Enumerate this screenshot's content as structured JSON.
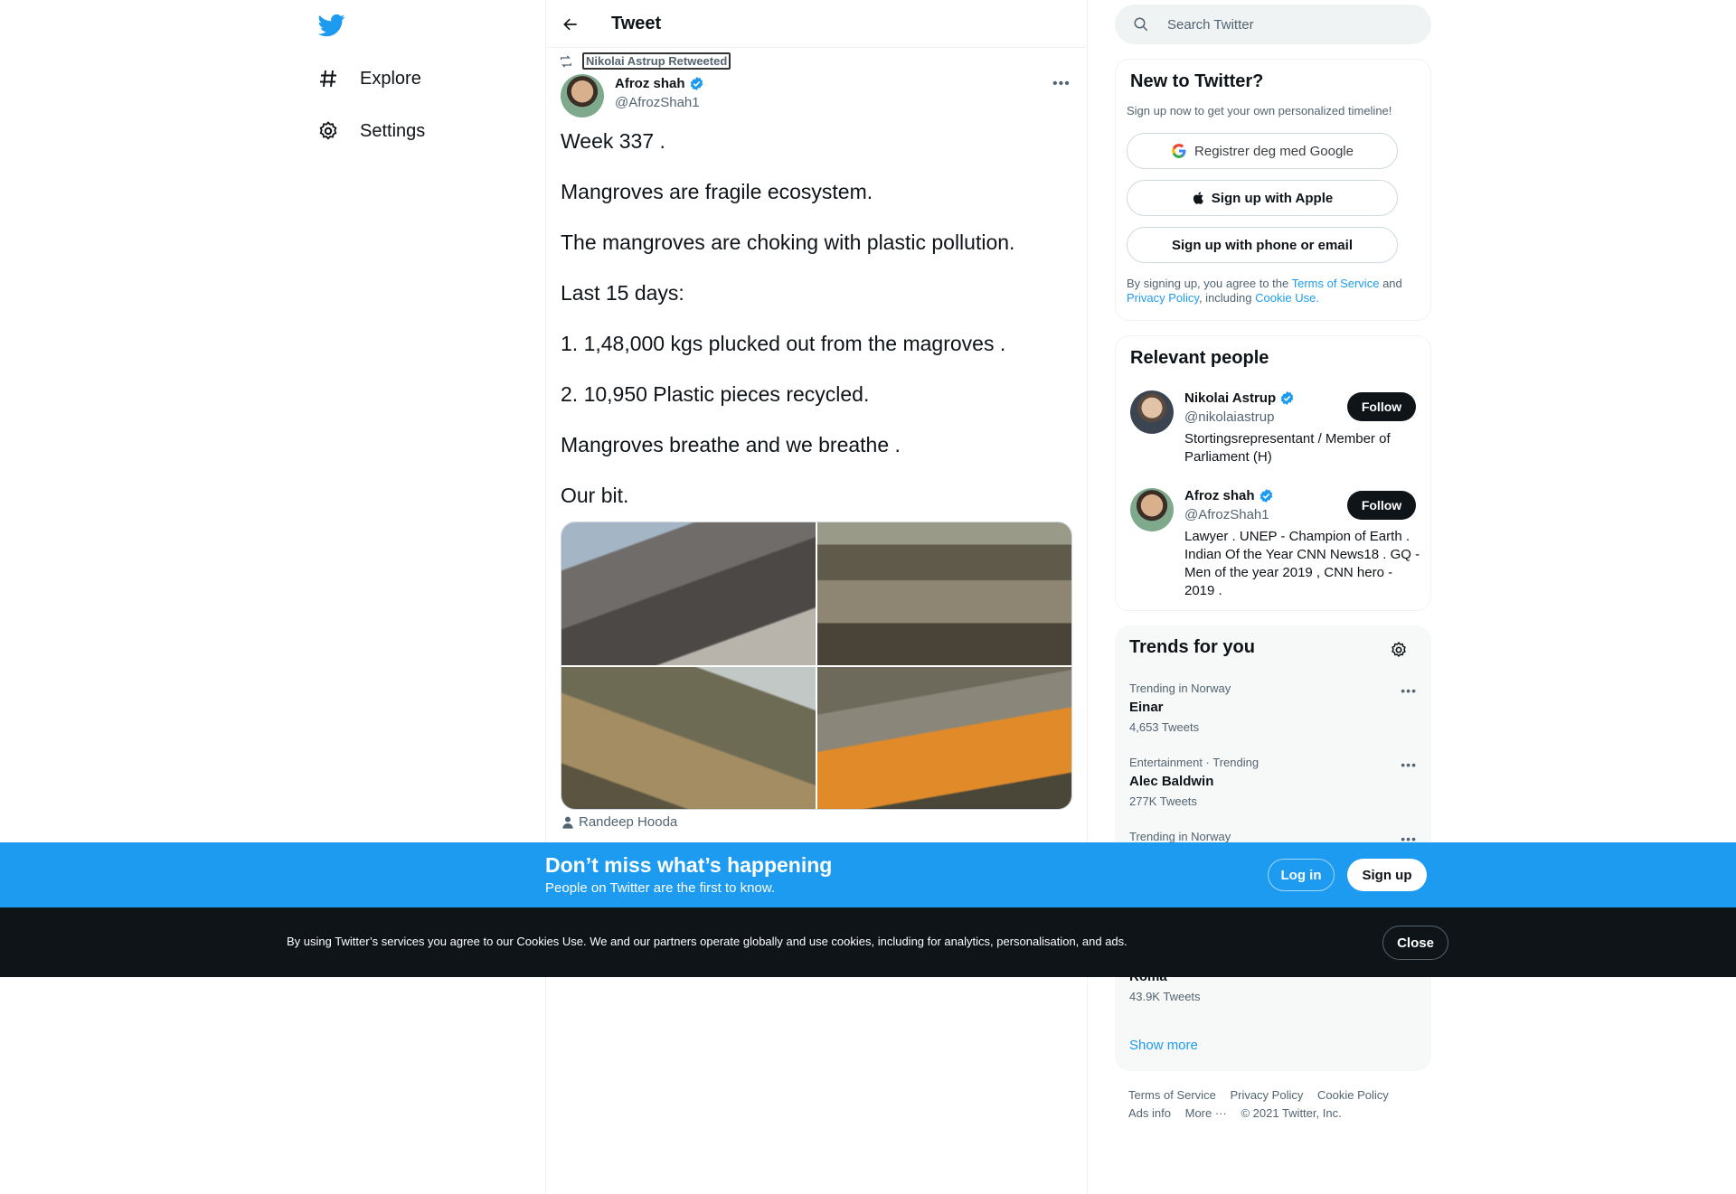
{
  "nav": {
    "logo_icon": "twitter-bird-icon",
    "items": [
      {
        "label": "Explore",
        "icon": "hashtag-icon"
      },
      {
        "label": "Settings",
        "icon": "gear-icon"
      }
    ]
  },
  "header": {
    "title": "Tweet",
    "back_icon": "arrow-left-icon"
  },
  "tweet": {
    "retweeted_by": "Nikolai Astrup Retweeted",
    "author_name": "Afroz shah",
    "author_handle": "@AfrozShah1",
    "paragraphs": [
      "Week 337 .",
      "Mangroves are fragile ecosystem.",
      "The mangroves are choking with plastic pollution.",
      "Last 15 days:",
      "1. 1,48,000 kgs plucked out from the magroves .",
      "2. 10,950 Plastic pieces recycled.",
      "Mangroves breathe and we breathe .",
      "Our bit."
    ],
    "tagged_user": "Randeep Hooda"
  },
  "search": {
    "placeholder": "Search Twitter"
  },
  "new_to_twitter": {
    "title": "New to Twitter?",
    "subtitle": "Sign up now to get your own personalized timeline!",
    "google_label": "Registrer deg med Google",
    "apple_label": "Sign up with Apple",
    "phone_label": "Sign up with phone or email",
    "legal_prefix": "By signing up, you agree to the",
    "terms_link": "Terms of Service",
    "and": "and",
    "privacy_link": "Privacy Policy",
    "including": ", including",
    "cookie_link": "Cookie Use."
  },
  "relevant_people": {
    "title": "Relevant people",
    "people": [
      {
        "name": "Nikolai Astrup",
        "handle": "@nikolaiastrup",
        "bio": "Stortingsrepresentant / Member of Parliament (H)",
        "follow": "Follow"
      },
      {
        "name": "Afroz shah",
        "handle": "@AfrozShah1",
        "bio": "Lawyer . UNEP - Champion of Earth . Indian Of the Year CNN News18 . GQ - Men of the year 2019 , CNN hero - 2019 .",
        "follow": "Follow"
      }
    ]
  },
  "trends": {
    "title": "Trends for you",
    "items": [
      {
        "meta": "Trending in Norway",
        "name": "Einar",
        "count": "4,653 Tweets"
      },
      {
        "meta": "Entertainment · Trending",
        "name": "Alec Baldwin",
        "count": "277K Tweets"
      },
      {
        "meta": "Trending in Norway",
        "name": "",
        "count": ""
      },
      {
        "meta": "",
        "name": "Roma",
        "count": "43.9K Tweets"
      }
    ],
    "show_more": "Show more"
  },
  "footer": {
    "links": [
      "Terms of Service",
      "Privacy Policy",
      "Cookie Policy",
      "Ads info",
      "More ···"
    ],
    "copyright": "© 2021 Twitter, Inc."
  },
  "signup_bar": {
    "headline": "Don’t miss what’s happening",
    "subline": "People on Twitter are the first to know.",
    "login": "Log in",
    "signup": "Sign up"
  },
  "cookie_bar": {
    "text": "By using Twitter’s services you agree to our Cookies Use. We and our partners operate globally and use cookies, including for analytics, personalisation, and ads.",
    "close": "Close"
  },
  "colors": {
    "accent": "#1d9bf0",
    "text": "#0f1419",
    "secondary": "#536471",
    "dark": "#0f1419"
  }
}
